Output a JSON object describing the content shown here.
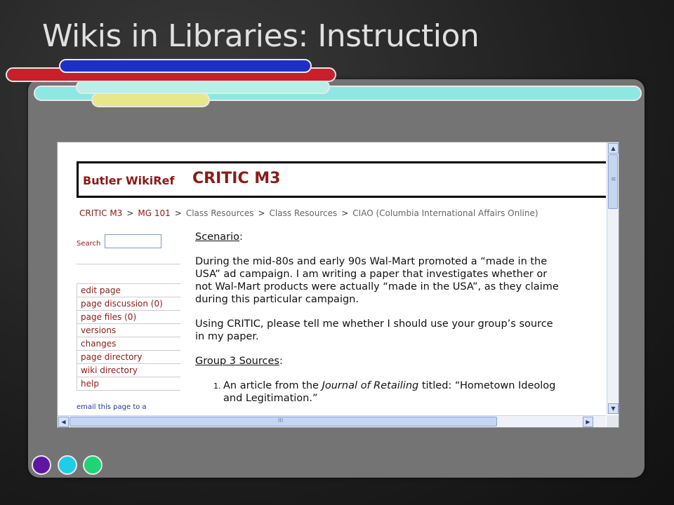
{
  "slide": {
    "title": "Wikis in Libraries: Instruction"
  },
  "colors": {
    "red": "#c81f2a",
    "blue": "#1d2fc9",
    "cyan": "#8ee8e2",
    "yellow": "#e6e88a",
    "purple": "#5d16a4",
    "teal": "#1ecde6",
    "green": "#1fd474",
    "wiki_red": "#8b1a1a"
  },
  "wiki": {
    "brand": "Butler WikiRef",
    "title": "CRITIC M3",
    "breadcrumb": {
      "items": [
        "CRITIC M3",
        "MG 101",
        "Class Resources",
        "Class Resources",
        "CIAO (Columbia International Affairs Online)"
      ],
      "separator": ">"
    },
    "search": {
      "label": "Search",
      "value": ""
    },
    "menu": [
      "edit page",
      "page discussion (0)",
      "page files (0)",
      "versions",
      "changes",
      "page directory",
      "wiki directory",
      "help"
    ],
    "email_link": "email this page to a",
    "scenario_heading": "Scenario",
    "scenario_colon": ":",
    "paragraph1": [
      "During the mid-80s and early 90s Wal-Mart promoted a “made in the",
      "USA” ad campaign.  I am writing a paper that investigates whether or",
      "not Wal-Mart products were actually “made in the USA”, as they claime",
      "during this particular campaign."
    ],
    "paragraph2": [
      "Using CRITIC, please tell me whether I should use your group’s source",
      "in my paper."
    ],
    "sources_heading": "Group 3 Sources",
    "sources_colon": ":",
    "source1": {
      "prefix": "An article from the ",
      "journal": "Journal of Retailing",
      "suffix": " titled: “Hometown Ideolog",
      "line2": "and Legitimation.”"
    }
  },
  "scrollbar": {
    "grip": "≡",
    "hgrip": "III",
    "up": "▲",
    "down": "▼",
    "left": "◀",
    "right": "▶"
  }
}
